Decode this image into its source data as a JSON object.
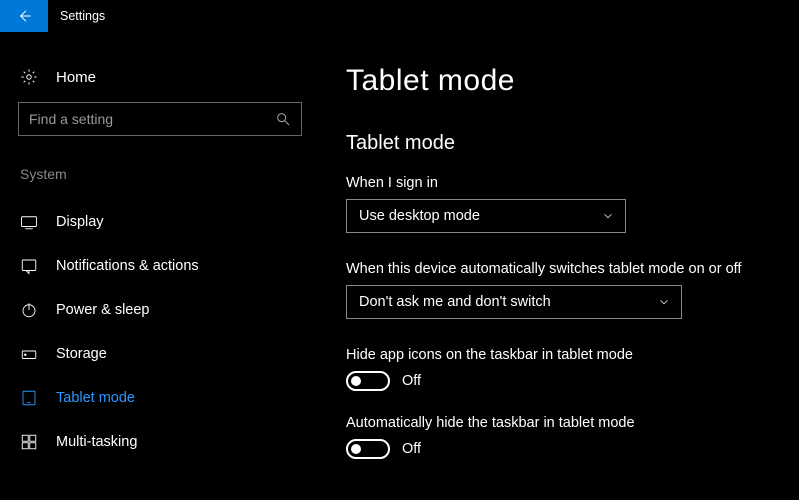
{
  "app": {
    "title": "Settings"
  },
  "sidebar": {
    "home_label": "Home",
    "search_placeholder": "Find a setting",
    "category": "System",
    "items": [
      {
        "label": "Display"
      },
      {
        "label": "Notifications & actions"
      },
      {
        "label": "Power & sleep"
      },
      {
        "label": "Storage"
      },
      {
        "label": "Tablet mode"
      },
      {
        "label": "Multi-tasking"
      }
    ]
  },
  "main": {
    "page_title": "Tablet mode",
    "section_title": "Tablet mode",
    "sign_in": {
      "label": "When I sign in",
      "value": "Use desktop mode"
    },
    "auto_switch": {
      "label": "When this device automatically switches tablet mode on or off",
      "value": "Don't ask me and don't switch"
    },
    "hide_icons": {
      "label": "Hide app icons on the taskbar in tablet mode",
      "state": "Off"
    },
    "auto_hide_taskbar": {
      "label": "Automatically hide the taskbar in tablet mode",
      "state": "Off"
    }
  }
}
